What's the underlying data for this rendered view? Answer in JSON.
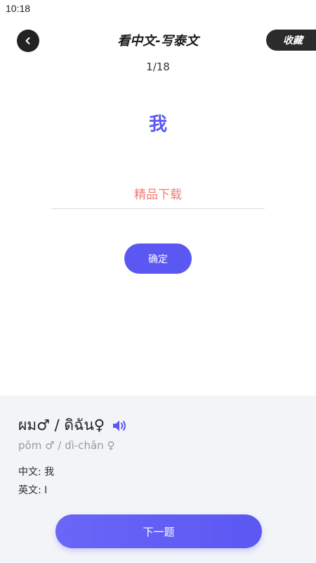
{
  "status_bar": {
    "time": "10:18"
  },
  "header": {
    "title": "看中文-写泰文",
    "favorite_label": "收藏"
  },
  "quiz": {
    "progress": "1/18",
    "word": "我",
    "answer_value": "精品下载",
    "confirm_label": "确定"
  },
  "info": {
    "thai": "ผม♂ / ดิฉัน♀",
    "romanization": "pǒm ♂ / dì-chǎn ♀",
    "chinese_label": "中文:",
    "chinese_value": "我",
    "english_label": "英文:",
    "english_value": "I"
  },
  "footer": {
    "next_label": "下一题"
  },
  "colors": {
    "accent": "#5b57f2",
    "answer_text": "#f27b72",
    "panel_bg": "#f3f4f8",
    "dark_button": "#2b2b2b"
  },
  "icons": {
    "back": "chevron-left-icon",
    "speaker": "speaker-icon"
  }
}
